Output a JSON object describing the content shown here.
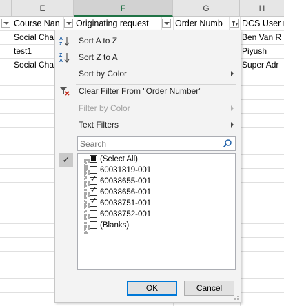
{
  "columns": [
    {
      "letter": "E",
      "header": "Course Nan",
      "selected": false
    },
    {
      "letter": "F",
      "header": "Originating request",
      "selected": true
    },
    {
      "letter": "G",
      "header": "Order Numb",
      "selected": false
    },
    {
      "letter": "H",
      "header": "DCS User n",
      "selected": false
    }
  ],
  "rows": [
    {
      "course": "Social Cha",
      "user": "Ben Van R"
    },
    {
      "course": "test1",
      "user": "Piyush"
    },
    {
      "course": "Social Cha",
      "user": "Super Adr"
    }
  ],
  "menu": {
    "sort_asc": "Sort A to Z",
    "sort_desc": "Sort Z to A",
    "sort_color": "Sort by Color",
    "clear_filter": "Clear Filter From \"Order Number\"",
    "filter_color": "Filter by Color",
    "text_filters": "Text Filters"
  },
  "search": {
    "placeholder": "Search"
  },
  "filter_values": [
    {
      "label": "(Select All)",
      "state": "partial"
    },
    {
      "label": "60031819-001",
      "state": "unchecked"
    },
    {
      "label": "60038655-001",
      "state": "checked"
    },
    {
      "label": "60038656-001",
      "state": "checked"
    },
    {
      "label": "60038751-001",
      "state": "checked"
    },
    {
      "label": "60038752-001",
      "state": "unchecked"
    },
    {
      "label": "(Blanks)",
      "state": "unchecked"
    }
  ],
  "buttons": {
    "ok": "OK",
    "cancel": "Cancel"
  },
  "colors": {
    "accent": "#217346",
    "focus": "#0078d7",
    "icon_blue": "#1e5fa8",
    "clear_red": "#c42b1c"
  }
}
